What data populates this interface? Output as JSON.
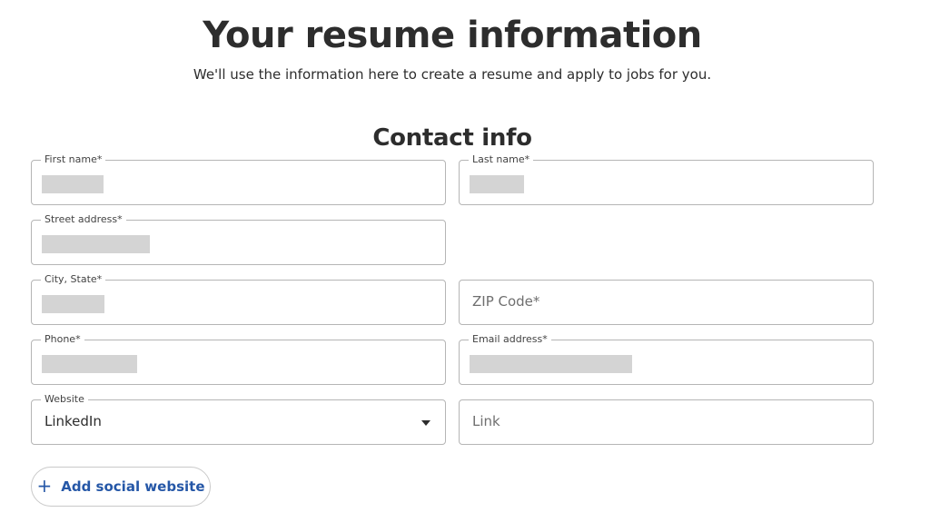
{
  "header": {
    "title": "Your resume information",
    "subtitle": "We'll use the information here to create a resume and apply to jobs for you."
  },
  "section": {
    "title": "Contact info"
  },
  "fields": {
    "first_name": {
      "label": "First name*"
    },
    "last_name": {
      "label": "Last name*"
    },
    "street_address": {
      "label": "Street address*"
    },
    "city_state": {
      "label": "City, State*"
    },
    "zip_code": {
      "placeholder": "ZIP Code*"
    },
    "phone": {
      "label": "Phone*"
    },
    "email": {
      "label": "Email address*"
    },
    "website": {
      "label": "Website",
      "selected": "LinkedIn"
    },
    "link": {
      "placeholder": "Link"
    }
  },
  "actions": {
    "add_social_label": "Add social website",
    "add_social_icon": "plus-icon"
  },
  "colors": {
    "accent": "#2557a7",
    "text": "#2d2d2d",
    "border": "#b5b5b5",
    "redacted": "#d4d4d4"
  }
}
